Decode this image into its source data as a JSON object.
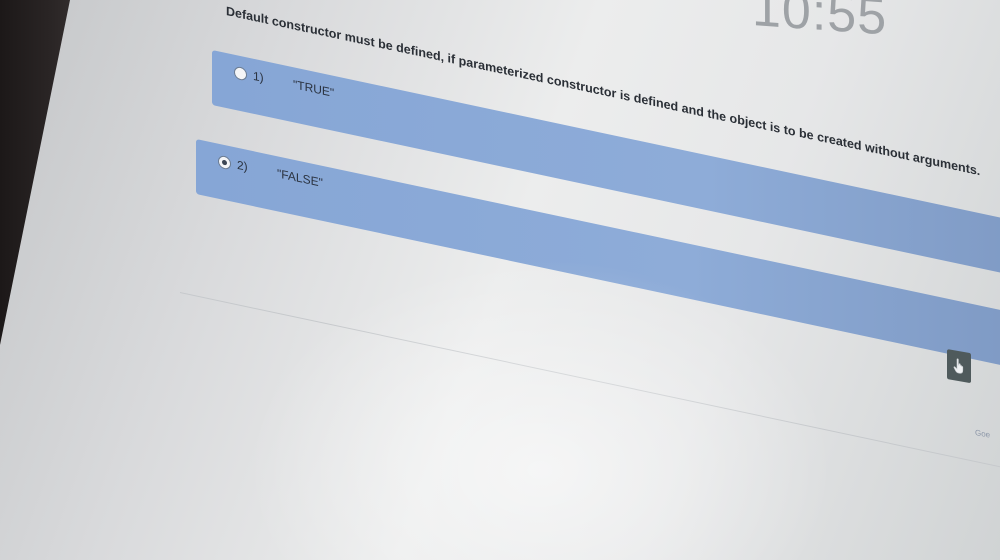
{
  "timer": {
    "text": "10:55"
  },
  "question": {
    "text": "Default constructor must be defined, if parameterized constructor is defined and the object is to be created without arguments."
  },
  "options": [
    {
      "number": "1)",
      "text": "\"TRUE\"",
      "selected": false
    },
    {
      "number": "2)",
      "text": "\"FALSE\"",
      "selected": true
    }
  ],
  "next_button": {
    "icon": "hand-pointer-icon"
  },
  "footer": {
    "link_text": "Goe"
  },
  "colors": {
    "option_bg": "#8eacd8",
    "button_bg": "#4f5a5c",
    "text": "#2a2f36"
  }
}
